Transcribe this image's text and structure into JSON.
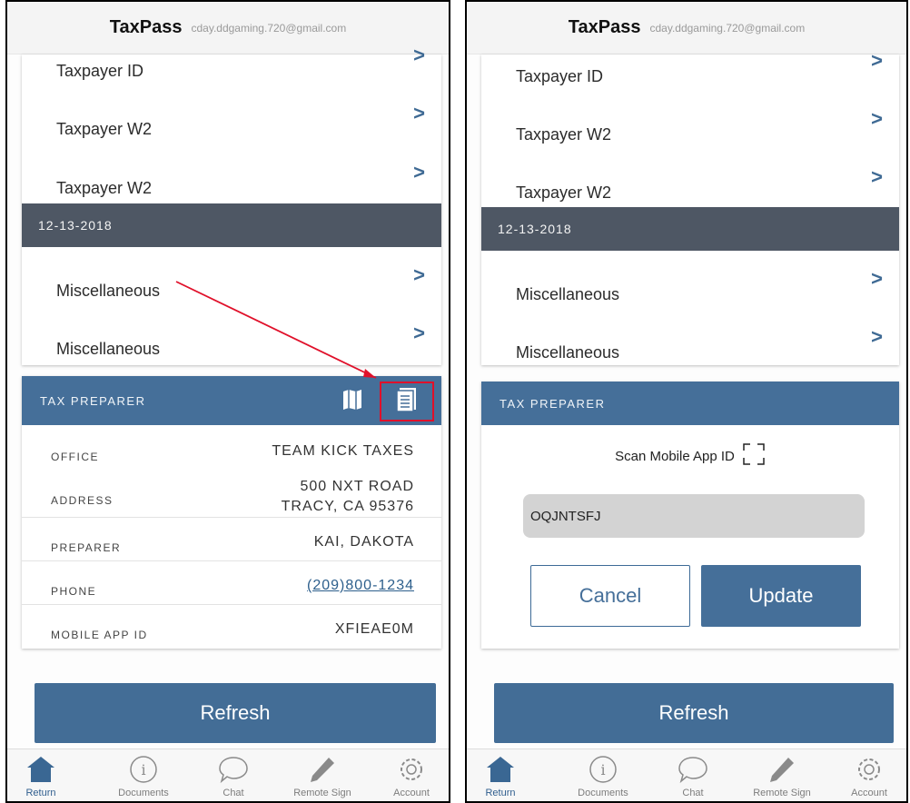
{
  "app": {
    "title": "TaxPass",
    "email": "cday.ddgaming.720@gmail.com"
  },
  "documents": {
    "items_top": [
      {
        "label": "Taxpayer ID"
      },
      {
        "label": "Taxpayer W2"
      },
      {
        "label": "Taxpayer W2"
      }
    ],
    "date_group": "12-13-2018",
    "items_bottom": [
      {
        "label": "Miscellaneous"
      },
      {
        "label": "Miscellaneous"
      }
    ],
    "chevron": ">"
  },
  "preparer": {
    "header": "TAX PREPARER",
    "icons": [
      "map-icon",
      "document-list-icon"
    ],
    "office_label": "OFFICE",
    "office_value": "TEAM KICK TAXES",
    "address_label": "ADDRESS",
    "address_line1": "500 NXT ROAD",
    "address_line2": "TRACY, CA 95376",
    "preparer_label": "PREPARER",
    "preparer_value": "KAI, DAKOTA",
    "phone_label": "PHONE",
    "phone_value": "(209)800-1234",
    "app_id_label": "MOBILE APP ID",
    "app_id_value": "XFIEAE0M"
  },
  "edit_form": {
    "header": "TAX PREPARER",
    "scan_label": "Scan Mobile App ID",
    "app_id_input": "OQJNTSFJ",
    "cancel_label": "Cancel",
    "update_label": "Update"
  },
  "refresh_label": "Refresh",
  "tabs": [
    {
      "label": "Return",
      "icon": "home-icon",
      "active": true
    },
    {
      "label": "Documents",
      "icon": "info-icon",
      "active": false
    },
    {
      "label": "Chat",
      "icon": "chat-bubble-icon",
      "active": false
    },
    {
      "label": "Remote Sign",
      "icon": "pencil-icon",
      "active": false
    },
    {
      "label": "Account",
      "icon": "gear-icon",
      "active": false
    }
  ],
  "colors": {
    "primary": "#456f99",
    "date_band": "#4e5764",
    "annotation": "#e0102a"
  }
}
